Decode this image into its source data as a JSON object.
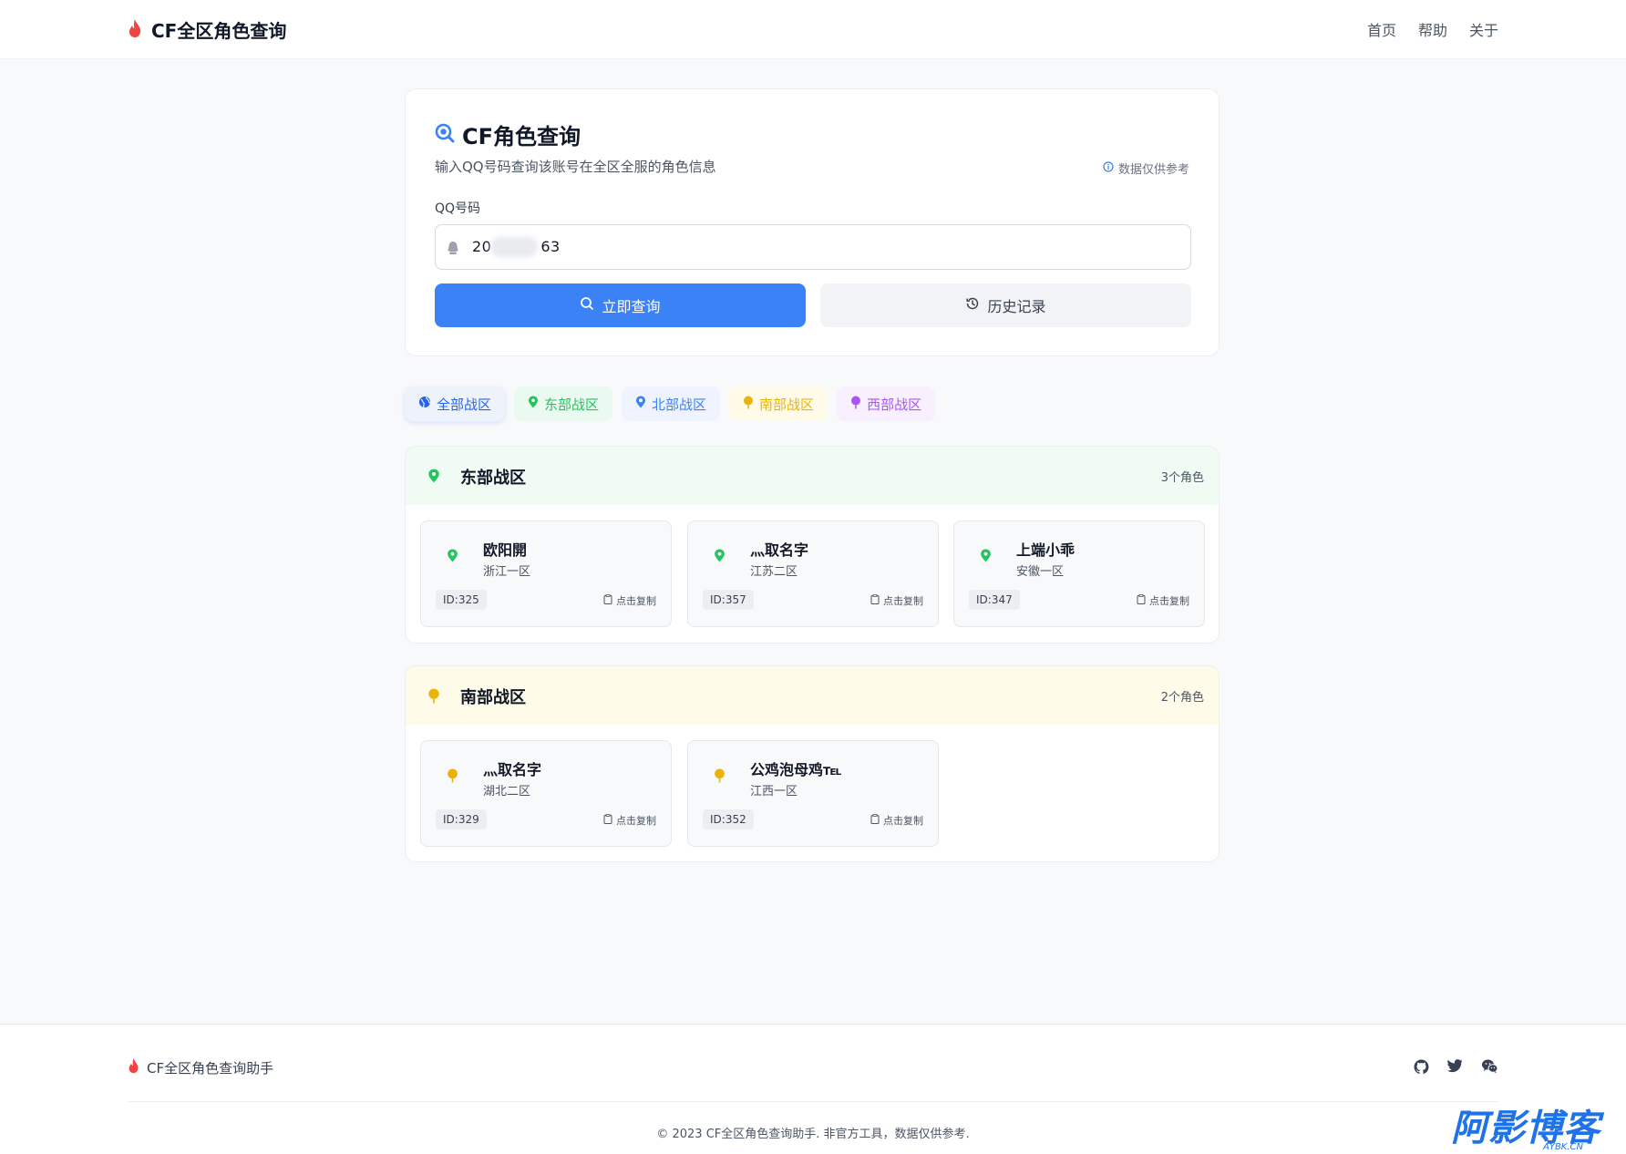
{
  "colors": {
    "primary": "#3b82f6",
    "east": "#22c55e",
    "north": "#3b82f6",
    "south": "#eab308",
    "west": "#a855f7",
    "brand": "#ef4444"
  },
  "header": {
    "brand_icon": "flame-icon",
    "title": "CF全区角色查询",
    "nav": [
      "首页",
      "帮助",
      "关于"
    ]
  },
  "search": {
    "title_icon": "search-icon",
    "title": "CF角色查询",
    "subtitle": "输入QQ号码查询该账号在全区全服的角色信息",
    "note_icon": "info-icon",
    "note": "数据仅供参考",
    "field_label": "QQ号码",
    "field_icon": "qq-icon",
    "field_value_start": "20",
    "field_value_end": "63",
    "query_button": "立即查询",
    "history_button": "历史记录"
  },
  "filters": [
    {
      "label": "全部战区",
      "icon": "globe-icon",
      "active": true
    },
    {
      "label": "东部战区",
      "icon": "map-pin-icon"
    },
    {
      "label": "北部战区",
      "icon": "map-pin-icon"
    },
    {
      "label": "南部战区",
      "icon": "balloon-icon"
    },
    {
      "label": "西部战区",
      "icon": "balloon-icon"
    }
  ],
  "zones": [
    {
      "name": "东部战区",
      "count": "3个角色",
      "roles": [
        {
          "name": "欧阳開",
          "server": "浙江一区",
          "id": "ID:325",
          "copy": "点击复制"
        },
        {
          "name": "灬取名字",
          "server": "江苏二区",
          "id": "ID:357",
          "copy": "点击复制"
        },
        {
          "name": "上端小乖",
          "server": "安徽一区",
          "id": "ID:347",
          "copy": "点击复制"
        }
      ]
    },
    {
      "name": "南部战区",
      "count": "2个角色",
      "roles": [
        {
          "name": "灬取名字",
          "server": "湖北二区",
          "id": "ID:329",
          "copy": "点击复制"
        },
        {
          "name": "公鸡泡母鸡℡",
          "server": "江西一区",
          "id": "ID:352",
          "copy": "点击复制"
        }
      ]
    }
  ],
  "footer": {
    "brand": "CF全区角色查询助手",
    "social_icons": [
      "github-icon",
      "twitter-icon",
      "wechat-icon"
    ],
    "copyright": "© 2023 CF全区角色查询助手. 非官方工具，数据仅供参考."
  },
  "watermark": {
    "text": "阿影博客",
    "sub": "AYBK.CN"
  }
}
